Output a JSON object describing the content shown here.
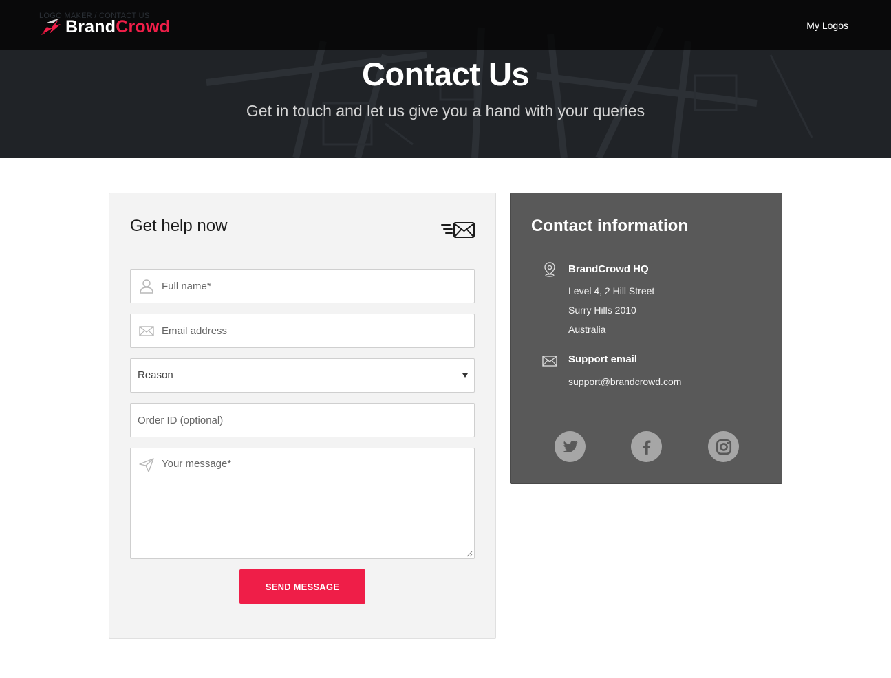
{
  "breadcrumb": "LOGO MAKER  /  CONTACT US",
  "brand": {
    "part1": "Brand",
    "part2": "Crowd",
    "accent": "#ef1e48"
  },
  "nav": {
    "my_logos": "My Logos"
  },
  "hero": {
    "title": "Contact Us",
    "subtitle": "Get in touch and let us give you a hand with your queries"
  },
  "form": {
    "title": "Get help now",
    "full_name_placeholder": "Full name*",
    "email_placeholder": "Email address",
    "reason_value": "Reason",
    "order_id_placeholder": "Order ID (optional)",
    "message_placeholder": "Your message*",
    "submit_label": "SEND MESSAGE"
  },
  "contact": {
    "title": "Contact information",
    "hq_title": "BrandCrowd HQ",
    "address": [
      "Level 4, 2 Hill Street",
      "Surry Hills 2010",
      "Australia"
    ],
    "email_title": "Support email",
    "email": "support@brandcrowd.com",
    "social": [
      "twitter-icon",
      "facebook-icon",
      "instagram-icon"
    ]
  }
}
